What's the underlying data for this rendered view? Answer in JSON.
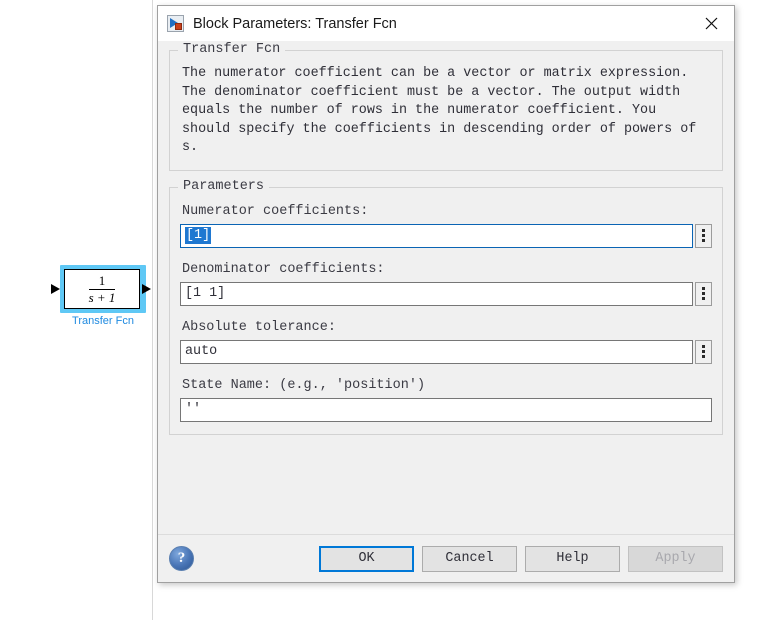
{
  "canvas": {
    "block": {
      "name": "Transfer Fcn",
      "numerator_display": "1",
      "denominator_display": "s + 1",
      "label_color": "#1f8ae0",
      "selection_color": "#5fc8f5",
      "selected": "true",
      "input_port_icon": "input-port-arrow",
      "output_port_icon": "output-port-arrow"
    }
  },
  "dialog": {
    "title": "Block Parameters: Transfer Fcn",
    "title_icon": "simulink-block-icon",
    "close_icon": "close-icon",
    "description_group": {
      "legend": "Transfer Fcn",
      "text": "The numerator coefficient can be a vector or matrix expression.\nThe denominator coefficient must be a vector. The output width\nequals the number of rows in the numerator coefficient. You\nshould specify the coefficients in descending order of powers of\ns."
    },
    "parameters_group": {
      "legend": "Parameters",
      "fields": [
        {
          "label": "Numerator coefficients:",
          "value": "[1]",
          "selected": "true",
          "has_dots_button": "true",
          "dots_icon": "vertical-ellipsis-icon"
        },
        {
          "label": "Denominator coefficients:",
          "value": "[1 1]",
          "selected": "false",
          "has_dots_button": "true",
          "dots_icon": "vertical-ellipsis-icon"
        },
        {
          "label": "Absolute tolerance:",
          "value": "auto",
          "selected": "false",
          "has_dots_button": "true",
          "dots_icon": "vertical-ellipsis-icon"
        },
        {
          "label": "State Name: (e.g., 'position')",
          "value": "''",
          "selected": "false",
          "has_dots_button": "false",
          "dots_icon": ""
        }
      ]
    },
    "footer": {
      "help_icon": "help-question-icon",
      "buttons": [
        {
          "label": "OK",
          "state": "default"
        },
        {
          "label": "Cancel",
          "state": "normal"
        },
        {
          "label": "Help",
          "state": "normal"
        },
        {
          "label": "Apply",
          "state": "disabled"
        }
      ]
    }
  },
  "colors": {
    "accent_focus": "#0078d7",
    "selection_highlight": "#1f78d1",
    "dialog_bg": "#f0f0f0",
    "block_label": "#1f8ae0"
  }
}
